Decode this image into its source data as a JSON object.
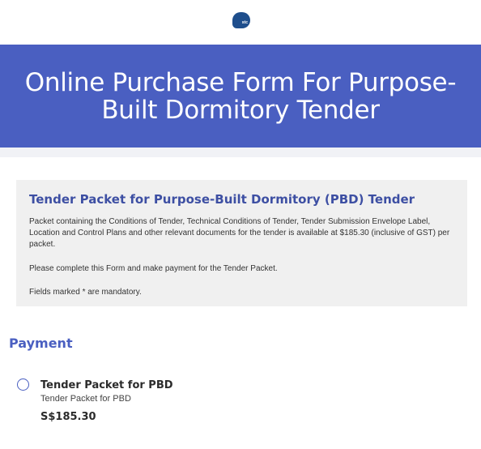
{
  "header": {
    "logo_text": "stc"
  },
  "hero": {
    "title": "Online Purchase Form For Purpose-Built Dormitory Tender"
  },
  "info": {
    "heading": "Tender Packet for Purpose-Built Dormitory (PBD) Tender",
    "paragraph1": "Packet containing the Conditions of Tender, Technical Conditions of Tender, Tender Submission Envelope Label, Location and Control Plans and other relevant documents for the tender is available at $185.30 (inclusive of GST) per packet.",
    "paragraph2": "Please complete this Form and make payment for the Tender Packet.",
    "paragraph3": "Fields marked * are mandatory."
  },
  "payment": {
    "title": "Payment",
    "option": {
      "title": "Tender Packet for PBD",
      "subtitle": "Tender Packet for PBD",
      "price": "S$185.30"
    }
  },
  "colors": {
    "brand": "#4a5fc1",
    "heading": "#3d4fa3",
    "panel_bg": "#f0f0f0"
  }
}
